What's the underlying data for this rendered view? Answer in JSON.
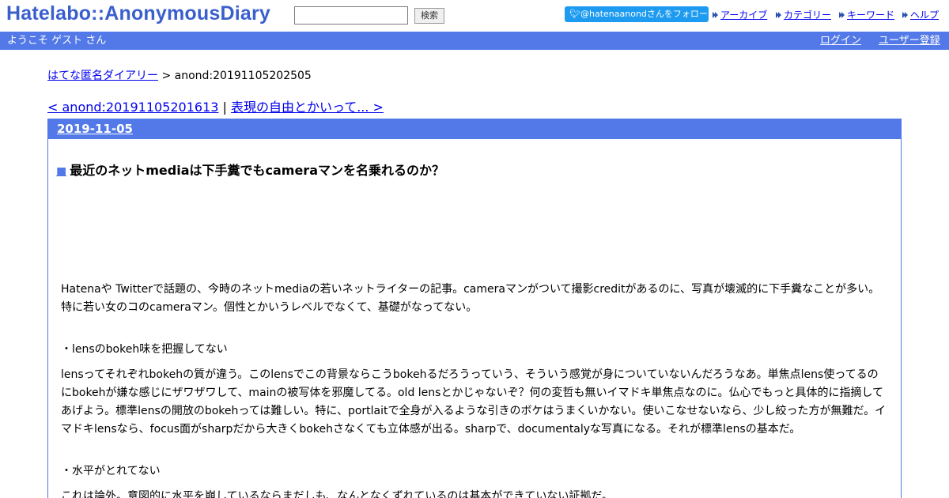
{
  "site": {
    "logo": "Hatelabo::AnonymousDiary",
    "search_placeholder": "",
    "search_button": "検索",
    "twitter_follow": "@hatenaanondさんをフォロー",
    "links": [
      "アーカイブ",
      "カテゴリー",
      "キーワード",
      "ヘルプ"
    ]
  },
  "userbar": {
    "welcome": "ようこそ ゲスト さん",
    "login": "ログイン",
    "signup": "ユーザー登録"
  },
  "breadcrumb": {
    "home": "はてな匿名ダイアリー",
    "current": " > anond:20191105202505"
  },
  "nav": {
    "prev": "< anond:20191105201613",
    "separator": " | ",
    "next": "表現の自由とかいって... >"
  },
  "day": {
    "date": "2019-11-05"
  },
  "entry": {
    "title": "最近のネットmediaは下手糞でもcameraマンを名乗れるのか？",
    "paragraph1": "Hatenaや Twitterで話題の、今時のネットmediaの若いネットライターの記事。cameraマンがついて撮影creditがあるのに、写真が壊滅的に下手糞なことが多い。特に若い女のコのcameraマン。個性とかいうレベルでなくて、基礎がなってない。",
    "heading1": "・lensのbokeh味を把握してない",
    "paragraph2": "lensってそれぞれbokehの質が違う。このlensでこの背景ならこうbokehるだろうっていう、そういう感覚が身についていないんだろうなあ。単焦点lens使ってるのにbokehが嫌な感じにザワザワして、mainの被写体を邪魔してる。old lensとかじゃないぞ？何の変哲も無いイマドキ単焦点なのに。仏心でもっと具体的に指摘してあげよう。標準lensの開放のbokehっては難しい。特に、portlaitで全身が入るような引きのボケはうまくいかない。使いこなせないなら、少し絞った方が無難だ。イマドキlensなら、focus面がsharpだから大きくbokehさなくても立体感が出る。sharpで、documentalyな写真になる。それが標準lensの基本だ。",
    "heading2": "・水平がとれてない",
    "paragraph3": "これは論外。意図的に水平を崩しているならまだしも、なんとなくずれているのは基本ができていない証拠だ。"
  },
  "colors": {
    "accent": "#5279e7",
    "logo": "#3a5fcd",
    "twitter": "#1d9bf0",
    "link": "#0000ee"
  }
}
